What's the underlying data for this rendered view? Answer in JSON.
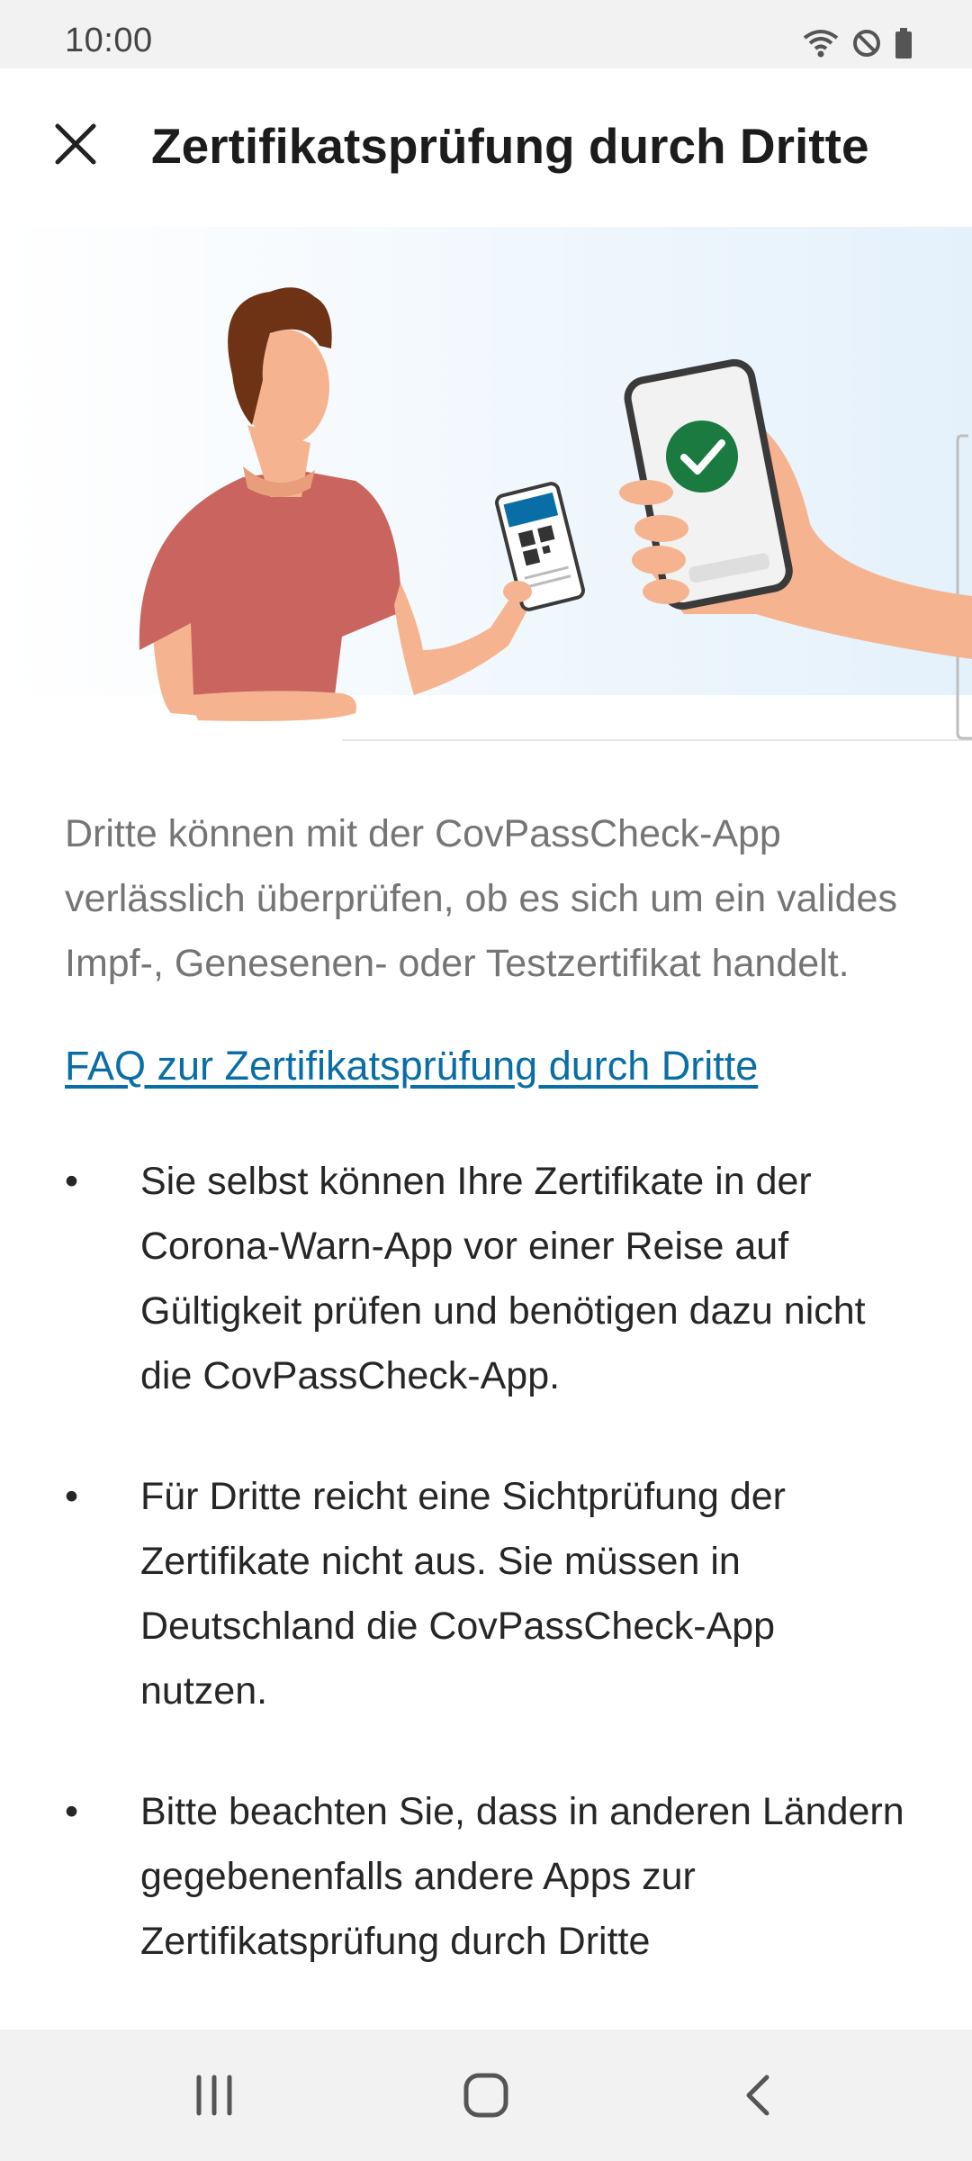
{
  "status_bar": {
    "time": "10:00",
    "icons": [
      "wifi-icon",
      "do-not-disturb-icon",
      "battery-icon"
    ]
  },
  "app_bar": {
    "close_icon": "close-icon",
    "title": "Zertifikatsprüfung durch Dritte"
  },
  "hero": {
    "illustration": "person-showing-qr-certificate-to-verifier-phone",
    "colors": {
      "shirt": "#c9655e",
      "skin": "#f5b48f",
      "hair": "#6e3215",
      "check": "#1a7a40",
      "accent": "#0a6ea6"
    }
  },
  "content": {
    "intro": "Dritte können mit der CovPassCheck-App verlässlich überprüfen, ob es sich um ein valides Impf-, Genesenen- oder Testzertifikat handelt.",
    "faq_link": "FAQ zur Zertifikatsprüfung durch Dritte",
    "bullet_symbol": "•",
    "bullets": [
      "Sie selbst können Ihre Zertifikate in der Corona-Warn-App vor einer Reise auf Gültigkeit prüfen und benötigen dazu nicht die CovPassCheck-App.",
      "Für Dritte reicht eine Sichtprüfung der Zertifikate nicht aus. Sie müssen in Deutschland die CovPassCheck-App nutzen.",
      "Bitte beachten Sie, dass in anderen Ländern gegebenenfalls andere Apps zur Zertifikatsprüfung durch Dritte"
    ]
  },
  "nav_bar": {
    "icons": [
      "recent-apps-icon",
      "home-icon",
      "back-icon"
    ]
  }
}
